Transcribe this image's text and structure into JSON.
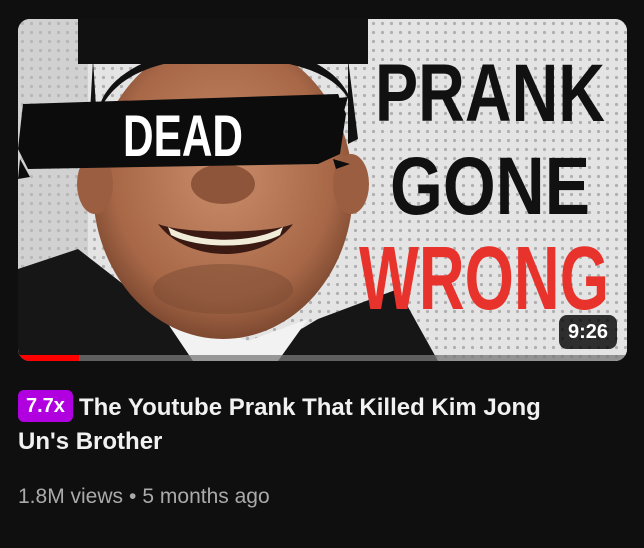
{
  "video": {
    "thumbnail": {
      "overlay_eye_text": "DEAD",
      "overlay_line1": "PRANK",
      "overlay_line2": "GONE",
      "overlay_line3": "WRONG",
      "overlay_line3_color": "#e8322c"
    },
    "duration": "9:26",
    "progress_watched_fraction": 0.1,
    "speed_badge": "7.7x",
    "speed_badge_color": "#b000e0",
    "title": "The Youtube Prank That Killed Kim Jong Un's Brother",
    "views": "1.8M views",
    "separator": "•",
    "published": "5 months ago"
  }
}
